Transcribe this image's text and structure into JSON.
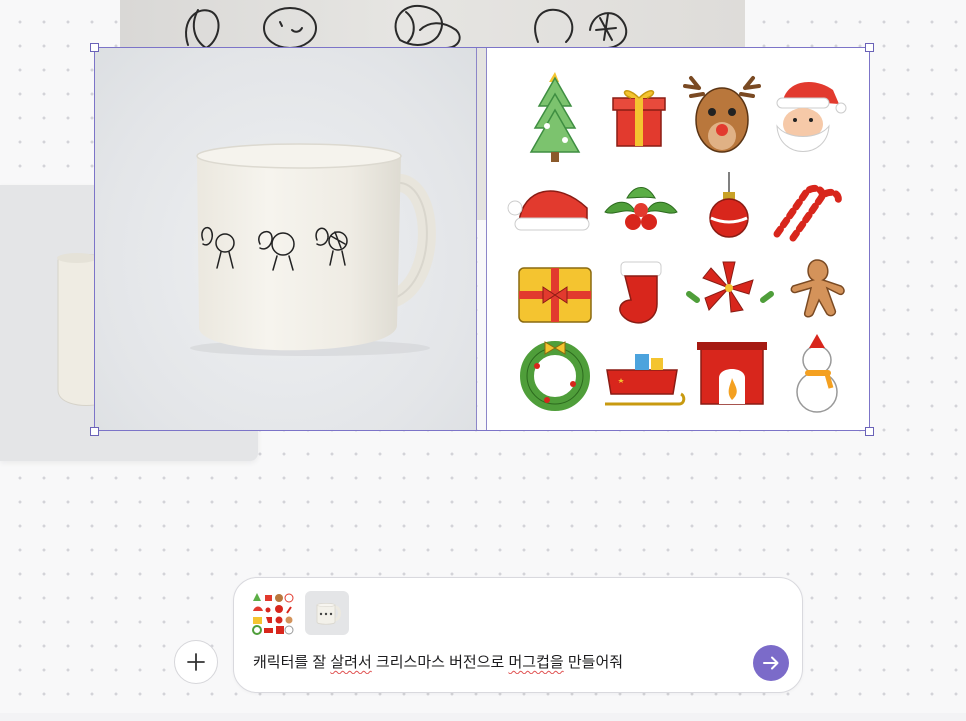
{
  "canvas": {
    "background_sketch": {
      "kind": "sketch-characters"
    },
    "background_mug": {
      "kind": "mug-photo"
    }
  },
  "selection": {
    "accent_color": "#7c74c8",
    "images": [
      {
        "kind": "mug-photo"
      },
      {
        "kind": "christmas-sticker-sheet"
      }
    ]
  },
  "stickers": [
    "christmas-tree-icon",
    "gift-box-icon",
    "reindeer-icon",
    "santa-face-icon",
    "santa-hat-icon",
    "holly-icon",
    "ornament-icon",
    "candy-canes-icon",
    "wrapped-present-icon",
    "stocking-icon",
    "poinsettia-icon",
    "gingerbread-man-icon",
    "wreath-icon",
    "sleigh-icon",
    "fireplace-icon",
    "snowman-icon"
  ],
  "composer": {
    "add_icon": "plus-icon",
    "attachments": [
      {
        "kind": "sticker-sheet-thumbnail"
      },
      {
        "kind": "mug-thumbnail"
      }
    ],
    "prompt_segments": [
      "캐릭터를 잘 ",
      "살려서",
      " 크리스마스 버전으로 ",
      "머그컵을",
      " 만들어줘"
    ],
    "send_icon": "arrow-right-icon",
    "send_color": "#7b6bc9"
  }
}
